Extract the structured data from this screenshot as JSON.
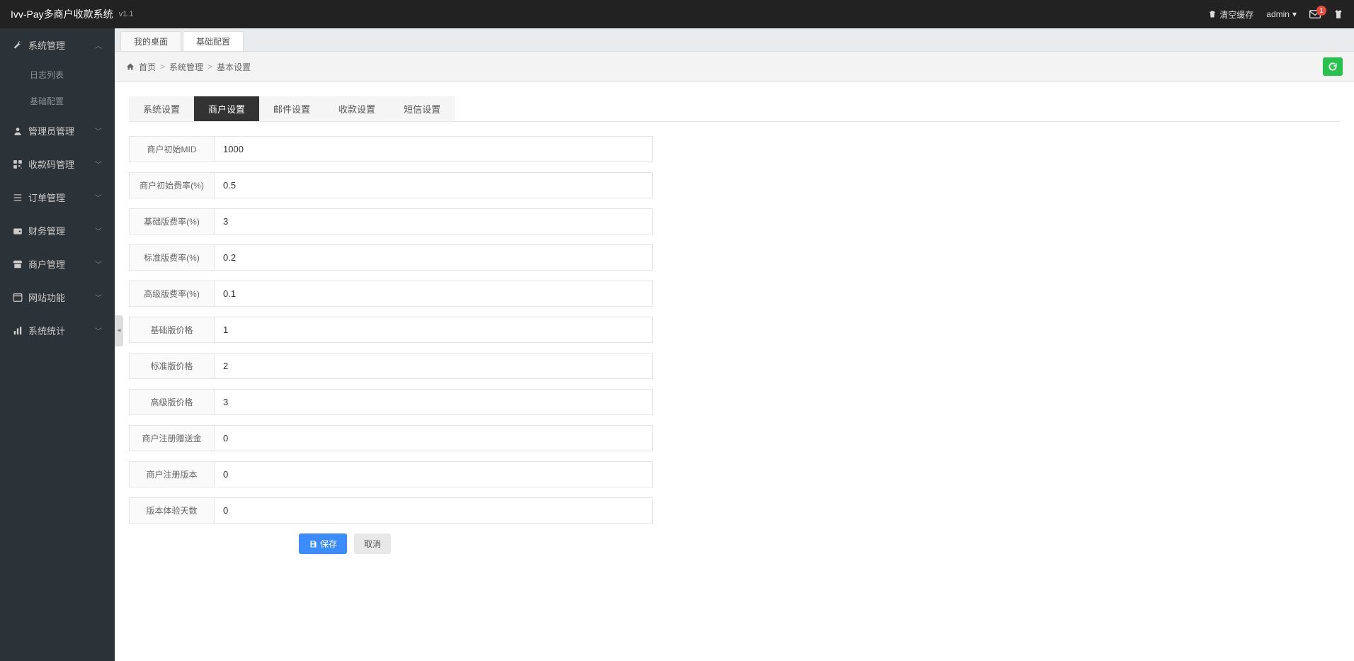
{
  "header": {
    "title": "Ivv-Pay多商户收款系统",
    "version": "v1.1",
    "clear_cache": "清空缓存",
    "user": "admin",
    "mail_badge": "1"
  },
  "sidebar": {
    "items": [
      {
        "icon": "wrench",
        "label": "系统管理",
        "open": true,
        "children": [
          {
            "label": "日志列表"
          },
          {
            "label": "基础配置"
          }
        ]
      },
      {
        "icon": "user",
        "label": "管理员管理"
      },
      {
        "icon": "qrcode",
        "label": "收款码管理"
      },
      {
        "icon": "list",
        "label": "订单管理"
      },
      {
        "icon": "wallet",
        "label": "财务管理"
      },
      {
        "icon": "shop",
        "label": "商户管理"
      },
      {
        "icon": "window",
        "label": "网站功能"
      },
      {
        "icon": "chart",
        "label": "系统统计"
      }
    ]
  },
  "tabs": [
    {
      "label": "我的桌面",
      "active": false
    },
    {
      "label": "基础配置",
      "active": true
    }
  ],
  "breadcrumb": {
    "home": "首页",
    "mid": "系统管理",
    "last": "基本设置"
  },
  "inner_tabs": [
    {
      "label": "系统设置",
      "active": false
    },
    {
      "label": "商户设置",
      "active": true
    },
    {
      "label": "邮件设置",
      "active": false
    },
    {
      "label": "收款设置",
      "active": false
    },
    {
      "label": "短信设置",
      "active": false
    }
  ],
  "form": {
    "fields": [
      {
        "label": "商户初始MID",
        "value": "1000"
      },
      {
        "label": "商户初始费率(%)",
        "value": "0.5"
      },
      {
        "label": "基础版费率(%)",
        "value": "3"
      },
      {
        "label": "标准版费率(%)",
        "value": "0.2"
      },
      {
        "label": "高级版费率(%)",
        "value": "0.1"
      },
      {
        "label": "基础版价格",
        "value": "1"
      },
      {
        "label": "标准版价格",
        "value": "2"
      },
      {
        "label": "高级版价格",
        "value": "3"
      },
      {
        "label": "商户注册赠送金",
        "value": "0"
      },
      {
        "label": "商户注册版本",
        "value": "0"
      },
      {
        "label": "版本体验天数",
        "value": "0"
      }
    ],
    "save": "保存",
    "cancel": "取消"
  }
}
